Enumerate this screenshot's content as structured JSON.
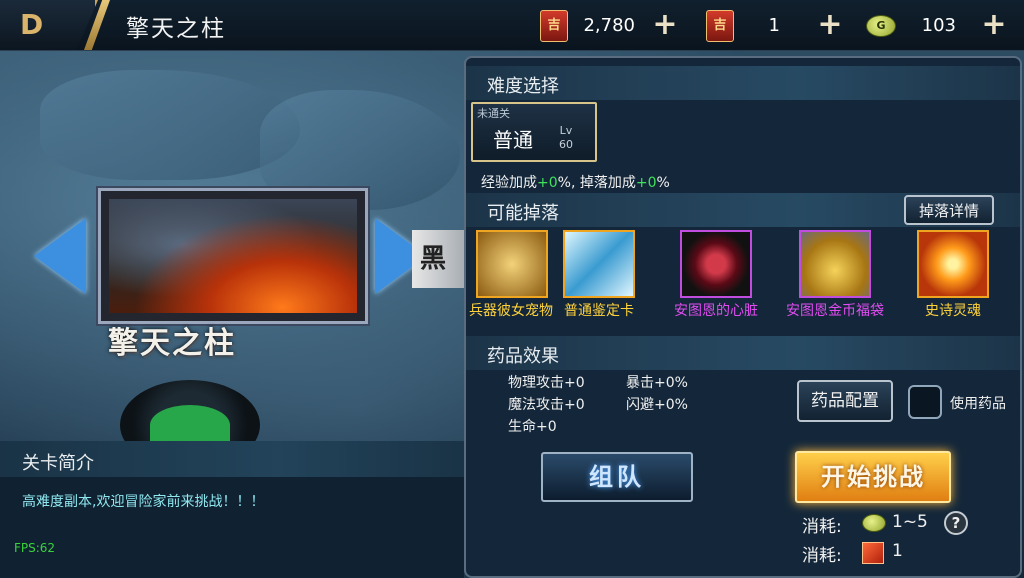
{
  "header": {
    "title": "擎天之柱",
    "back_glyph": "D",
    "currencies": [
      {
        "icon": "red-book-icon",
        "glyph": "吉",
        "value": "2,780"
      },
      {
        "icon": "red-book-icon",
        "glyph": "吉",
        "value": "1"
      },
      {
        "icon": "gold-coin-icon",
        "glyph": "G",
        "value": "103"
      }
    ],
    "plus_label": "+"
  },
  "stage": {
    "name": "擎天之柱",
    "next_stage_partial": "黑"
  },
  "intro": {
    "title": "关卡简介",
    "text": "高难度副本,欢迎冒险家前来挑战！！！"
  },
  "fps": "FPS:62",
  "panel": {
    "difficulty_title": "难度选择",
    "difficulty": {
      "status": "未通关",
      "name": "普通",
      "lv_label": "Lv",
      "lv_value": "60"
    },
    "bonus": {
      "exp_label": "经验加成",
      "exp_value": "+0",
      "drop_label": "%, 掉落加成",
      "drop_value": "+0",
      "suffix": "%"
    },
    "drops_title": "可能掉落",
    "drop_detail_btn": "掉落详情",
    "drops": [
      {
        "name": "兵器彼女宠物",
        "quality": "orange"
      },
      {
        "name": "普通鉴定卡",
        "quality": "orange"
      },
      {
        "name": "安图恩的心脏",
        "quality": "purple"
      },
      {
        "name": "安图恩金币福袋",
        "quality": "purple"
      },
      {
        "name": "史诗灵魂",
        "quality": "orange"
      }
    ],
    "potion_title": "药品效果",
    "potion_stats": {
      "phys_atk": "物理攻击+0",
      "crit": "暴击+0%",
      "magic_atk": "魔法攻击+0",
      "dodge": "闪避+0%",
      "hp": "生命+0"
    },
    "potion_config_btn": "药品配置",
    "use_potion_label": "使用药品",
    "team_btn": "组队",
    "start_btn": "开始挑战",
    "cost_label": "消耗:",
    "cost_coin": "1~5",
    "cost_ticket": "1",
    "help_glyph": "?"
  },
  "colors": {
    "orange_quality": "#f0a521",
    "purple_quality": "#c04de0",
    "green_value": "#3ee35a",
    "intro_text": "#8fe7f0",
    "drop_name_orange": "#ffd23a",
    "drop_name_purple": "#e04cf0"
  }
}
